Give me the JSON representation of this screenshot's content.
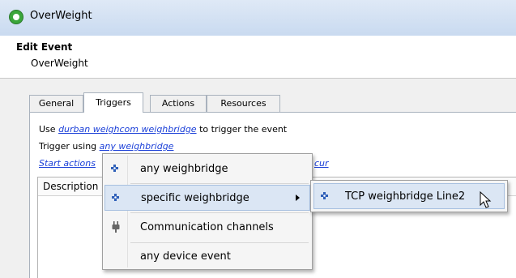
{
  "window": {
    "title": "OverWeight",
    "app_icon": "app-eye-icon"
  },
  "header": {
    "title": "Edit Event",
    "subtitle": "OverWeight"
  },
  "tabs": [
    {
      "label": "General",
      "active": false
    },
    {
      "label": "Triggers",
      "active": true
    },
    {
      "label": "Actions",
      "active": false
    },
    {
      "label": "Resources",
      "active": false
    }
  ],
  "triggers": {
    "line1_prefix": "Use",
    "line1_link": "durban weighcom weighbridge",
    "line1_suffix": "to trigger the event",
    "line2_prefix": "Trigger using",
    "line2_link": "any weighbridge",
    "line3_link_start": "Start actions",
    "line3_link_end": "cur"
  },
  "grid": {
    "column_description": "Description"
  },
  "context_menu": {
    "items": [
      {
        "label": "any weighbridge",
        "icon": "puzzle-icon"
      },
      {
        "label": "specific weighbridge",
        "icon": "puzzle-icon",
        "has_submenu": true,
        "highlighted": true
      },
      {
        "label": "Communication channels",
        "icon": "plug-icon"
      },
      {
        "label": "any device event",
        "icon": ""
      }
    ]
  },
  "submenu": {
    "items": [
      {
        "label": "TCP weighbridge Line2",
        "icon": "puzzle-icon",
        "highlighted": true
      }
    ]
  },
  "colors": {
    "link": "#1a3fd8",
    "highlight": "#dbe6f4",
    "title_bar": "#c9daf0"
  }
}
